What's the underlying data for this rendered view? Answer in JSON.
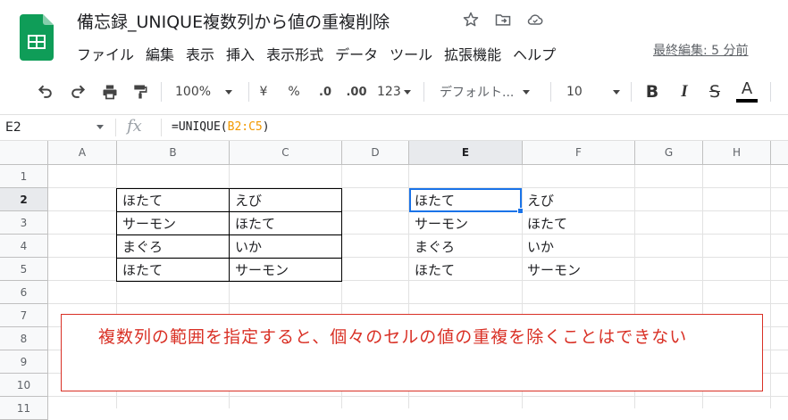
{
  "document": {
    "title": "備忘録_UNIQUE複数列から値の重複削除",
    "last_edit": "最終編集: 5 分前"
  },
  "menu": [
    "ファイル",
    "編集",
    "表示",
    "挿入",
    "表示形式",
    "データ",
    "ツール",
    "拡張機能",
    "ヘルプ"
  ],
  "toolbar": {
    "zoom": "100%",
    "currency": "¥",
    "percent": "%",
    "decimal_decrease": ".0",
    "decimal_increase": ".00",
    "more_formats": "123",
    "font": "デフォルト...",
    "font_size": "10",
    "bold": "B",
    "italic": "I",
    "strikethrough": "S",
    "text_color": "A"
  },
  "formula_bar": {
    "cell_ref": "E2",
    "fx": "fx",
    "formula_prefix": "=UNIQUE(",
    "formula_range": "B2:C5",
    "formula_suffix": ")"
  },
  "columns": [
    "A",
    "B",
    "C",
    "D",
    "E",
    "F",
    "G",
    "H"
  ],
  "rows": [
    "1",
    "2",
    "3",
    "4",
    "5",
    "6",
    "7",
    "8",
    "9",
    "10",
    "11"
  ],
  "source_table": [
    [
      "ほたて",
      "えび"
    ],
    [
      "サーモン",
      "ほたて"
    ],
    [
      "まぐろ",
      "いか"
    ],
    [
      "ほたて",
      "サーモン"
    ]
  ],
  "result_table": [
    [
      "ほたて",
      "えび"
    ],
    [
      "サーモン",
      "ほたて"
    ],
    [
      "まぐろ",
      "いか"
    ],
    [
      "ほたて",
      "サーモン"
    ]
  ],
  "note": "複数列の範囲を指定すると、個々のセルの値の重複を除くことはできない",
  "colors": {
    "accent": "#1a73e8",
    "note": "#d93025",
    "sheets_green": "#0f9d58",
    "range": "#f29900"
  }
}
